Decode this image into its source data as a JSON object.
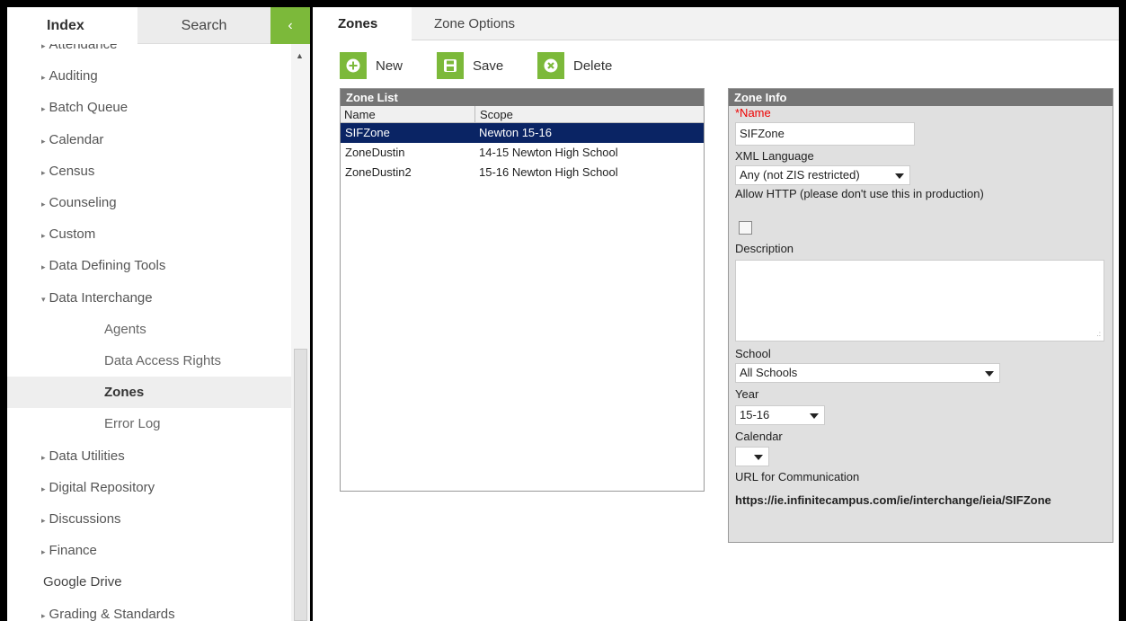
{
  "left_tabs": {
    "index": "Index",
    "search": "Search",
    "collapse": "‹"
  },
  "nav": {
    "items": [
      {
        "label": "Attendance",
        "arrow": "▸",
        "kind": "top"
      },
      {
        "label": "Auditing",
        "arrow": "▸",
        "kind": "top"
      },
      {
        "label": "Batch Queue",
        "arrow": "▸",
        "kind": "top"
      },
      {
        "label": "Calendar",
        "arrow": "▸",
        "kind": "top"
      },
      {
        "label": "Census",
        "arrow": "▸",
        "kind": "top"
      },
      {
        "label": "Counseling",
        "arrow": "▸",
        "kind": "top"
      },
      {
        "label": "Custom",
        "arrow": "▸",
        "kind": "top"
      },
      {
        "label": "Data Defining Tools",
        "arrow": "▸",
        "kind": "top"
      },
      {
        "label": "Data Interchange",
        "arrow": "▾",
        "kind": "top"
      },
      {
        "label": "Agents",
        "kind": "child"
      },
      {
        "label": "Data Access Rights",
        "kind": "child"
      },
      {
        "label": "Zones",
        "kind": "child",
        "selected": true
      },
      {
        "label": "Error Log",
        "kind": "child"
      },
      {
        "label": "Data Utilities",
        "arrow": "▸",
        "kind": "top"
      },
      {
        "label": "Digital Repository",
        "arrow": "▸",
        "kind": "top"
      },
      {
        "label": "Discussions",
        "arrow": "▸",
        "kind": "top"
      },
      {
        "label": "Finance",
        "arrow": "▸",
        "kind": "top"
      },
      {
        "label": "Google Drive",
        "kind": "plain"
      },
      {
        "label": "Grading & Standards",
        "arrow": "▸",
        "kind": "top"
      }
    ]
  },
  "tabs": {
    "zones": "Zones",
    "zone_options": "Zone Options"
  },
  "toolbar": {
    "new": "New",
    "save": "Save",
    "delete": "Delete"
  },
  "zone_list": {
    "title": "Zone List",
    "columns": {
      "name": "Name",
      "scope": "Scope"
    },
    "rows": [
      {
        "name": "SIFZone",
        "scope": "Newton 15-16",
        "selected": true
      },
      {
        "name": "ZoneDustin",
        "scope": "14-15 Newton High School"
      },
      {
        "name": "ZoneDustin2",
        "scope": "15-16 Newton High School"
      }
    ]
  },
  "zone_info": {
    "title": "Zone Info",
    "name_label": "*Name",
    "name_value": "SIFZone",
    "xml_label": "XML Language",
    "xml_value": "Any (not ZIS restricted)",
    "http_label": "Allow HTTP (please don't use this in production)",
    "http_checked": false,
    "desc_label": "Description",
    "desc_value": "",
    "school_label": "School",
    "school_value": "All Schools",
    "year_label": "Year",
    "year_value": "15-16",
    "calendar_label": "Calendar",
    "calendar_value": "",
    "url_label": "URL for Communication",
    "url_value": "https://ie.infinitecampus.com/ie/interchange/ieia/SIFZone"
  },
  "colors": {
    "accent": "#7cb93a",
    "selected_row": "#0a2464",
    "panel_header": "#757575"
  }
}
